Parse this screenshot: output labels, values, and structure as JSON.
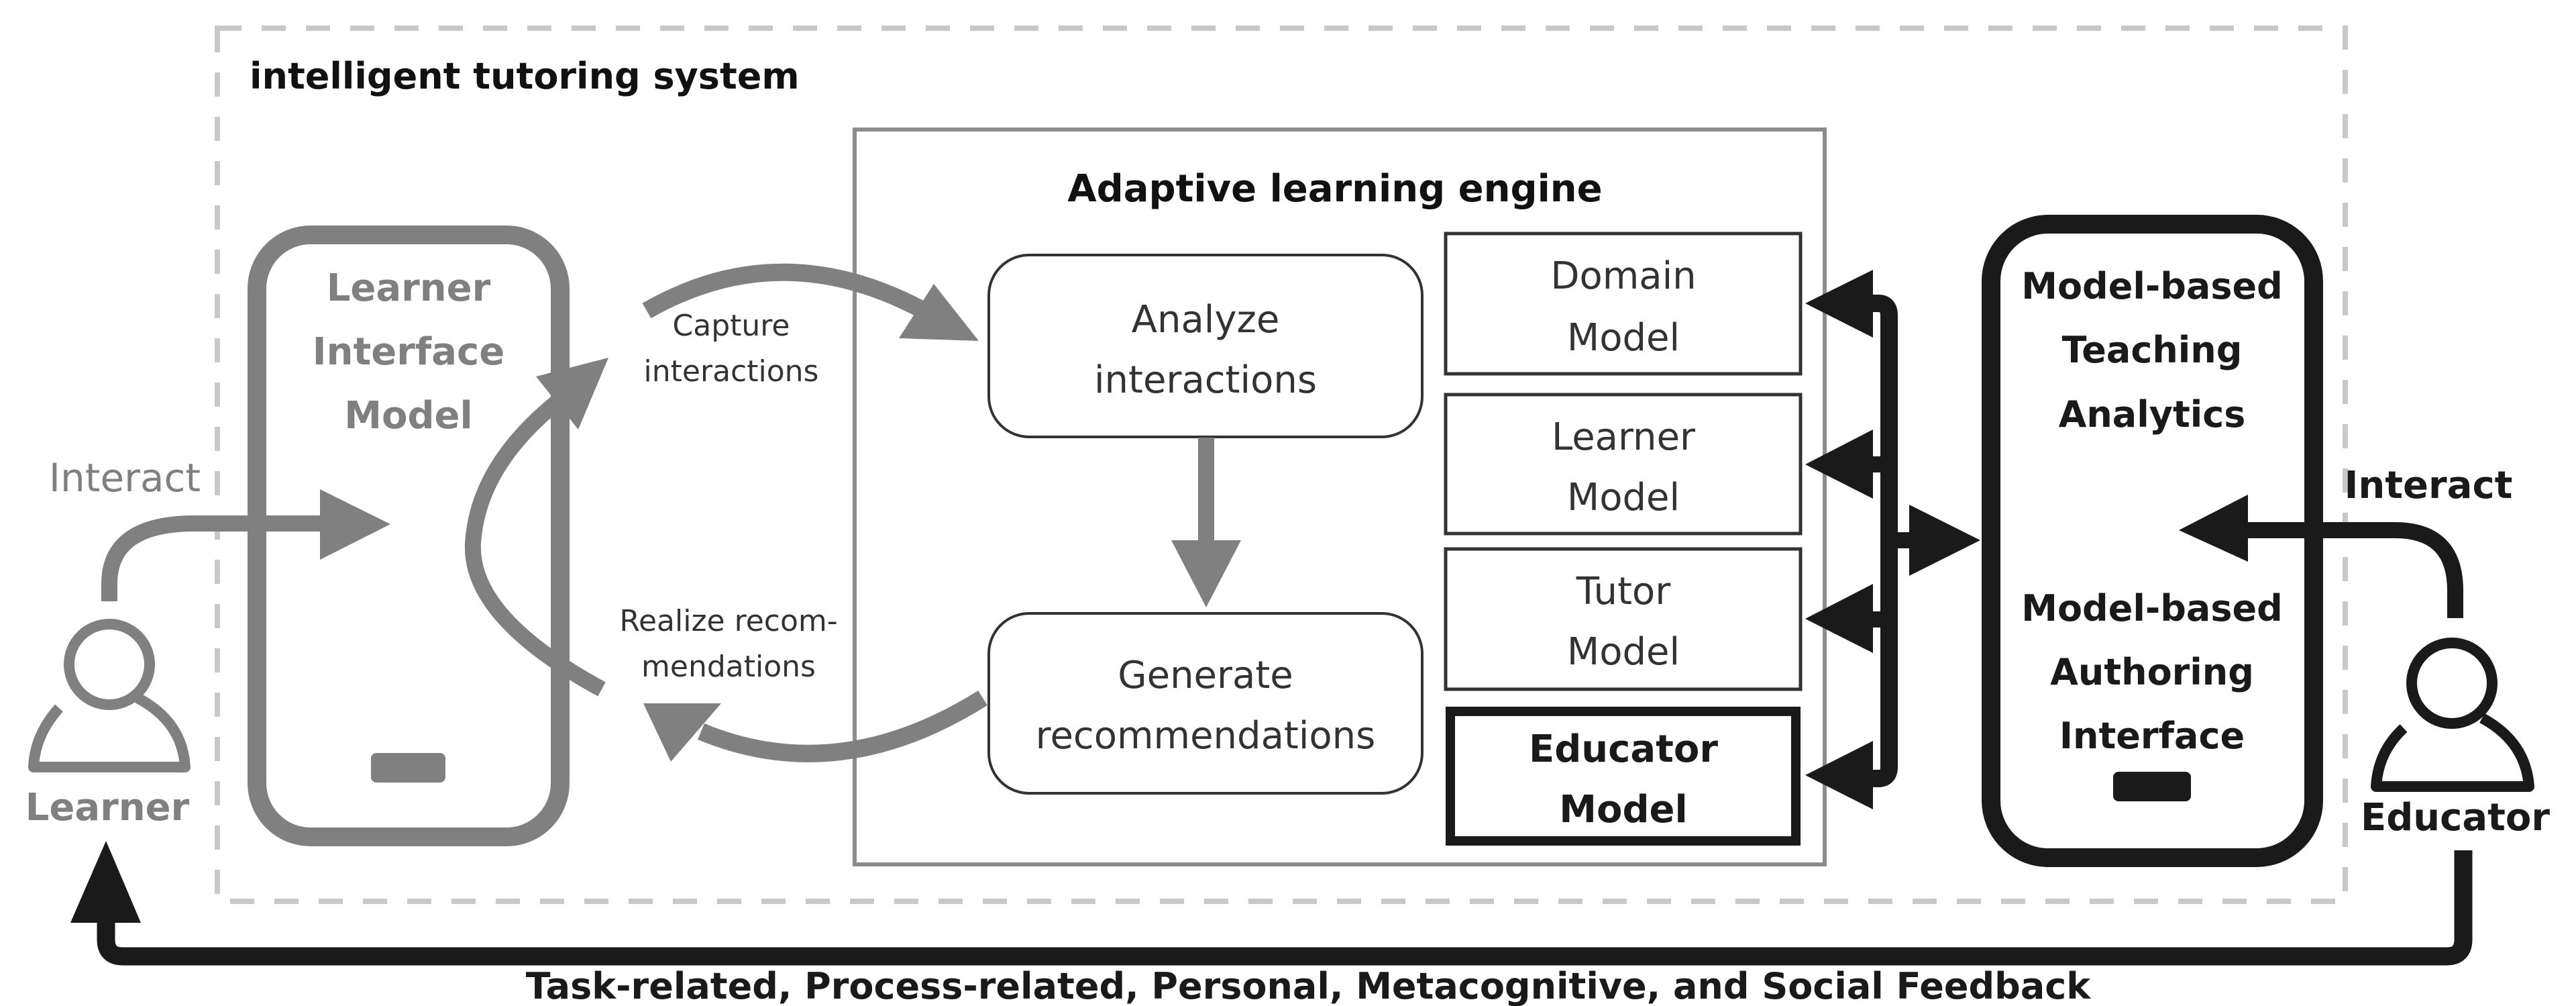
{
  "diagram": {
    "system_title": "intelligent tutoring system",
    "engine": {
      "title": "Adaptive learning engine",
      "processes": [
        {
          "id": "analyze",
          "lines": [
            "Analyze",
            "interactions"
          ]
        },
        {
          "id": "generate",
          "lines": [
            "Generate",
            "recommendations"
          ]
        }
      ],
      "models": [
        {
          "id": "domain",
          "lines": [
            "Domain",
            "Model"
          ],
          "emphasis": false
        },
        {
          "id": "learner",
          "lines": [
            "Learner",
            "Model"
          ],
          "emphasis": false
        },
        {
          "id": "tutor",
          "lines": [
            "Tutor",
            "Model"
          ],
          "emphasis": false
        },
        {
          "id": "educator",
          "lines": [
            "Educator",
            "Model"
          ],
          "emphasis": true
        }
      ]
    },
    "learner_interface": {
      "lines": [
        "Learner",
        "Interface",
        "Model"
      ]
    },
    "educator_interface": {
      "top_lines": [
        "Model-based",
        "Teaching",
        "Analytics"
      ],
      "bottom_lines": [
        "Model-based",
        "Authoring",
        "Interface"
      ]
    },
    "actors": {
      "learner": {
        "label": "Learner",
        "action": "Interact"
      },
      "educator": {
        "label": "Educator",
        "action": "Interact"
      }
    },
    "edge_labels": {
      "capture": [
        "Capture",
        "interactions"
      ],
      "realize": [
        "Realize recom-",
        "mendations"
      ]
    },
    "feedback_label": "Task-related, Process-related, Personal, Metacognitive, and Social Feedback",
    "colors": {
      "learner_side": "#808080",
      "educator_side": "#1a1a1a",
      "system_border": "#c8c8c8",
      "engine_border": "#8c8c8c"
    }
  }
}
